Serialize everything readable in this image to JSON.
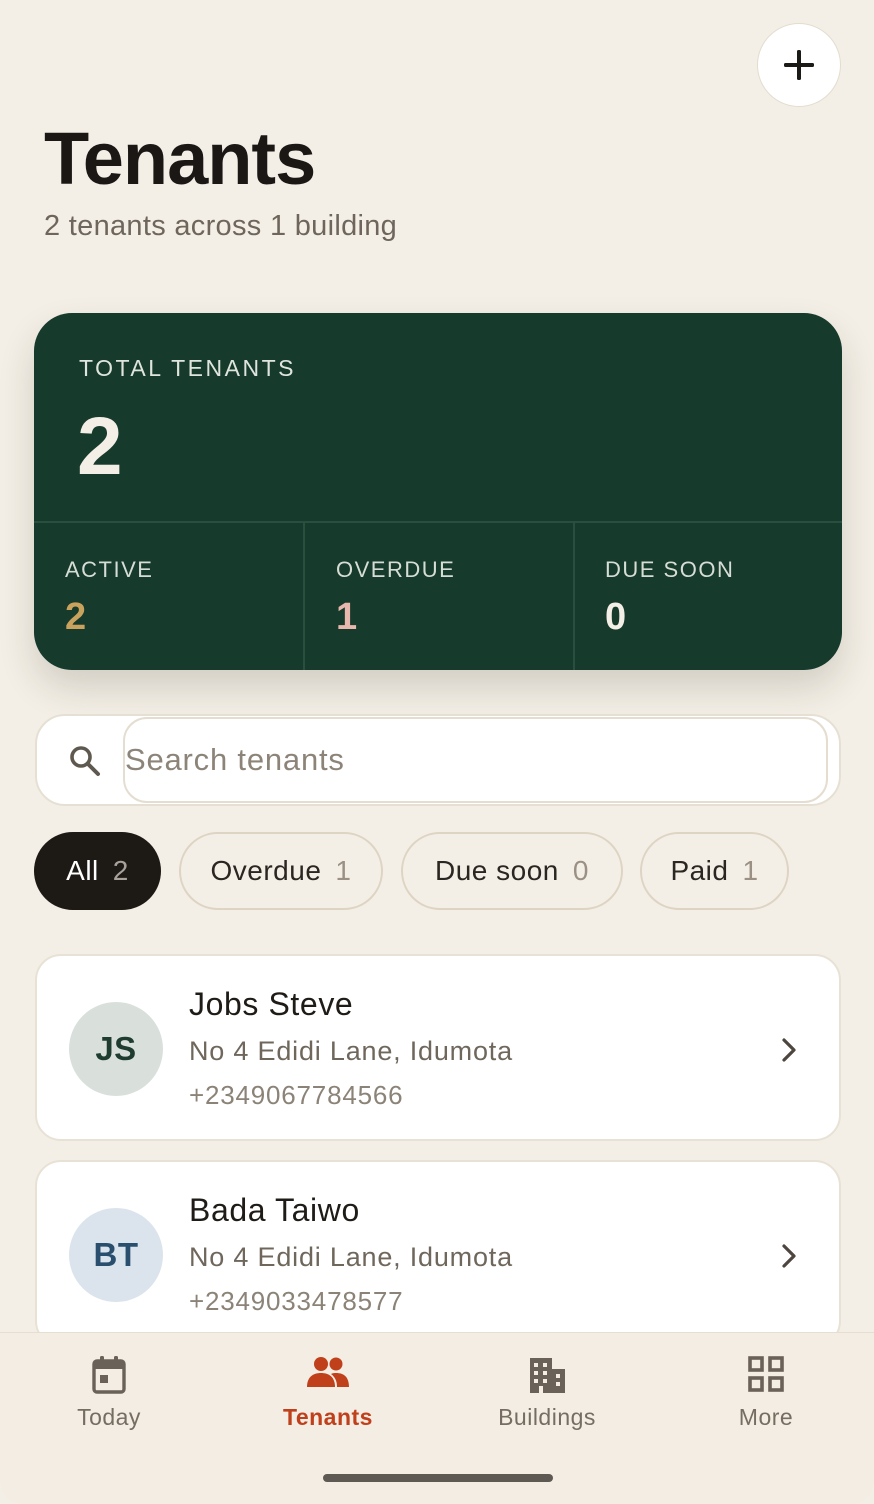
{
  "header": {
    "title": "Tenants",
    "subtitle": "2 tenants across 1 building",
    "add_icon": "plus-icon"
  },
  "summary": {
    "label": "TOTAL TENANTS",
    "count": "2",
    "stats": [
      {
        "label": "ACTIVE",
        "value": "2",
        "color": "#c9a35e"
      },
      {
        "label": "OVERDUE",
        "value": "1",
        "color": "#e8b8ae"
      },
      {
        "label": "DUE SOON",
        "value": "0",
        "color": "#f4efe6"
      }
    ],
    "bg_color": "#163a2b"
  },
  "search": {
    "placeholder": "Search tenants",
    "value": "",
    "icon": "search-icon"
  },
  "filters": [
    {
      "label": "All",
      "count": "2",
      "active": true
    },
    {
      "label": "Overdue",
      "count": "1",
      "active": false
    },
    {
      "label": "Due soon",
      "count": "0",
      "active": false
    },
    {
      "label": "Paid",
      "count": "1",
      "active": false
    }
  ],
  "tenants": [
    {
      "initials": "JS",
      "name": "Jobs Steve",
      "address": "No 4 Edidi Lane, Idumota",
      "phone": "+2349067784566",
      "avatar_bg": "#d9e0dc",
      "avatar_fg": "#1e3d30"
    },
    {
      "initials": "BT",
      "name": "Bada Taiwo",
      "address": "No 4 Edidi Lane, Idumota",
      "phone": "+2349033478577",
      "avatar_bg": "#dbe4ec",
      "avatar_fg": "#2a4f6e"
    }
  ],
  "nav": [
    {
      "label": "Today",
      "icon": "calendar-icon",
      "active": false
    },
    {
      "label": "Tenants",
      "icon": "people-icon",
      "active": true
    },
    {
      "label": "Buildings",
      "icon": "building-icon",
      "active": false
    },
    {
      "label": "More",
      "icon": "grid-icon",
      "active": false
    }
  ],
  "colors": {
    "accent": "#c0401b",
    "background": "#f4efe6"
  }
}
